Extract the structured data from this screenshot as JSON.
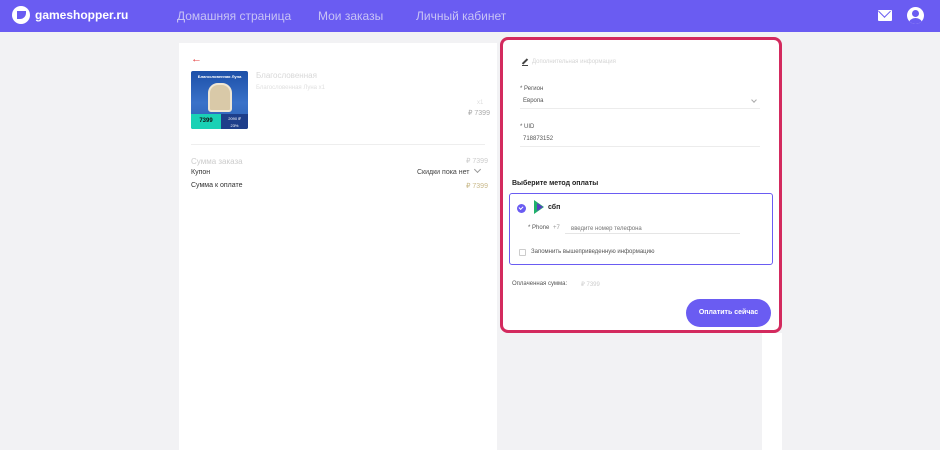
{
  "header": {
    "logo_text": "gameshopper.ru",
    "nav": [
      "Домашняя страница",
      "Мои заказы",
      "Личный кабинет"
    ]
  },
  "colors": {
    "accent": "#6a5cf2",
    "highlight_border": "#d32a5e",
    "sbp_green": "#1fb16b",
    "product_price_bg": "#1ad1b5"
  },
  "icons": {
    "mail": "mail-icon",
    "user": "user-icon",
    "edit": "edit-icon",
    "sbp": "sbp-icon"
  },
  "product": {
    "back": "←",
    "image_title": "Благословенная Луна",
    "image_price_left": "7399",
    "image_price_right_1": "2090 ₽",
    "image_price_right_2": "23%",
    "title": "Благословенная",
    "subtitle": "Благословенная Луна х1",
    "qty": "х1",
    "price": "₽ 7399"
  },
  "summary": {
    "total_label": "Сумма заказа",
    "total_value": "₽ 7399",
    "coupon_label": "Купон",
    "coupon_value": "Скидки пока нет",
    "pay_label": "Сумма к оплате",
    "pay_value": "₽ 7399"
  },
  "form": {
    "edit_label": "Дополнительная информация",
    "region_label": "* Регион",
    "region_value": "Европа",
    "uid_label": "* UID",
    "uid_value": "718873152",
    "payment_title": "Выберите метод оплаты",
    "sbp_name": "сбп",
    "phone_label": "* Phone",
    "phone_prefix": "+7",
    "phone_placeholder": "введите номер телефона",
    "remember_label": "Запомнить вышеприведенную информацию",
    "paid_label": "Оплаченная сумма:",
    "paid_value": "₽ 7399",
    "pay_button": "Оплатить сейчас"
  }
}
